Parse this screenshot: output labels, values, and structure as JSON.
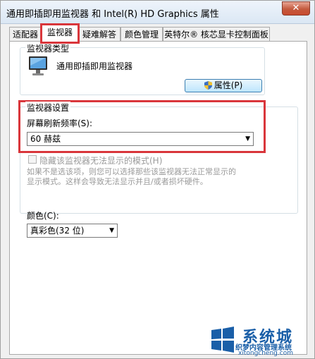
{
  "window": {
    "title": "通用即插即用监视器 和 Intel(R) HD Graphics 属性",
    "close_label": "✕"
  },
  "tabs": [
    {
      "label": "适配器"
    },
    {
      "label": "监视器"
    },
    {
      "label": "疑难解答"
    },
    {
      "label": "颜色管理"
    },
    {
      "label": "英特尔® 核芯显卡控制面板"
    }
  ],
  "monitor_type": {
    "group_label": "监视器类型",
    "name": "通用即插即用监视器",
    "properties_button": "属性(P)"
  },
  "monitor_settings": {
    "group_label": "监视器设置",
    "refresh_label": "屏幕刷新频率(S):",
    "refresh_value": "60 赫兹",
    "hide_modes_label": "隐藏该监视器无法显示的模式(H)",
    "hide_modes_checked": false,
    "hint_line1": "如果不是选该项，则您可以选择那些该监视器无法正常显示的",
    "hint_line2": "显示模式。这样会导致无法显示并且/或者损坏硬件。"
  },
  "color": {
    "label": "颜色(C):",
    "value": "真彩色(32 位)"
  },
  "watermark": {
    "line1": "系统城",
    "line2": "织梦内容管理系统",
    "line3": "xitongcheng.com"
  },
  "colors": {
    "highlight_red": "#d9363b",
    "button_blue": "#3c7fb1",
    "watermark_blue": "#1a5fa8"
  }
}
